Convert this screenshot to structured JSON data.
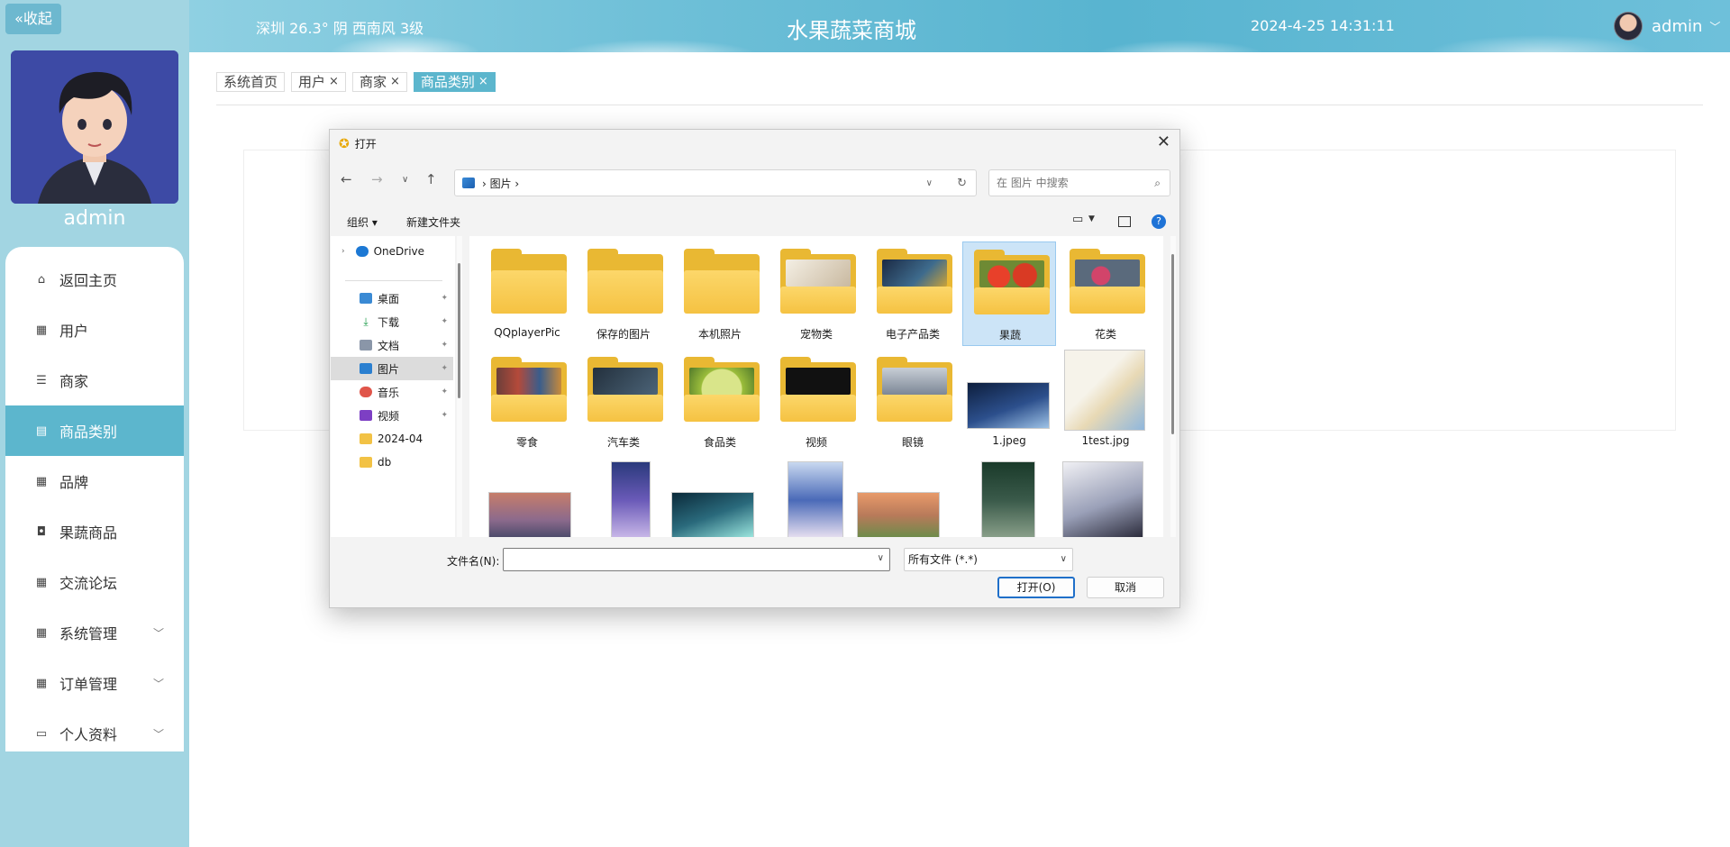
{
  "header": {
    "weather": "深圳  26.3°  阴  西南风  3级",
    "title": "水果蔬菜商城",
    "datetime": "2024-4-25 14:31:11",
    "user": "admin",
    "dropdown_icon": "chevron-down-icon"
  },
  "sidebar": {
    "collapse_label": "«收起",
    "profile_name": "admin",
    "items": [
      {
        "label": "返回主页",
        "icon": "home-icon"
      },
      {
        "label": "用户",
        "icon": "grid-icon"
      },
      {
        "label": "商家",
        "icon": "list-icon"
      },
      {
        "label": "商品类别",
        "icon": "clipboard-icon",
        "active": true
      },
      {
        "label": "品牌",
        "icon": "grid-icon"
      },
      {
        "label": "果蔬商品",
        "icon": "wallet-icon"
      },
      {
        "label": "交流论坛",
        "icon": "grid-icon"
      },
      {
        "label": "系统管理",
        "icon": "grid-icon",
        "expandable": true
      },
      {
        "label": "订单管理",
        "icon": "grid-icon",
        "expandable": true
      },
      {
        "label": "个人资料",
        "icon": "card-icon",
        "expandable": true
      }
    ]
  },
  "tabs": [
    {
      "label": "系统首页",
      "closable": false
    },
    {
      "label": "用户",
      "closable": true
    },
    {
      "label": "商家",
      "closable": true
    },
    {
      "label": "商品类别",
      "closable": true,
      "active": true
    }
  ],
  "tab_close_glyph": "×",
  "dialog": {
    "title": "打开",
    "close_glyph": "✕",
    "breadcrumb": "›  图片  ›",
    "search_placeholder": "在 图片 中搜索",
    "organize": "组织 ▾",
    "new_folder": "新建文件夹",
    "help": "?",
    "nav_items": [
      {
        "label": "OneDrive",
        "icon": "cloud-icon",
        "pinned": false
      },
      {
        "label": "桌面",
        "icon": "desktop-icon",
        "pinned": true
      },
      {
        "label": "下载",
        "icon": "download-icon",
        "pinned": true
      },
      {
        "label": "文档",
        "icon": "document-icon",
        "pinned": true
      },
      {
        "label": "图片",
        "icon": "pictures-icon",
        "pinned": true,
        "selected": true
      },
      {
        "label": "音乐",
        "icon": "music-icon",
        "pinned": true
      },
      {
        "label": "视频",
        "icon": "video-icon",
        "pinned": true
      },
      {
        "label": "2024-04",
        "icon": "folder-icon",
        "pinned": false
      },
      {
        "label": "db",
        "icon": "folder-icon",
        "pinned": false
      }
    ],
    "files": [
      {
        "label": "QQplayerPic",
        "kind": "folder"
      },
      {
        "label": "保存的图片",
        "kind": "folder"
      },
      {
        "label": "本机照片",
        "kind": "folder"
      },
      {
        "label": "宠物类",
        "kind": "photo-folder",
        "color": "#e7e2d8"
      },
      {
        "label": "电子产品类",
        "kind": "photo-folder",
        "color": "#2f4b6a"
      },
      {
        "label": "果蔬",
        "kind": "photo-folder",
        "color": "#d9432a",
        "selected": true
      },
      {
        "label": "花类",
        "kind": "photo-folder",
        "color": "#c9516e"
      },
      {
        "label": "零食",
        "kind": "photo-folder",
        "color": "#6b3f3a"
      },
      {
        "label": "汽车类",
        "kind": "photo-folder",
        "color": "#3a4c5e"
      },
      {
        "label": "食品类",
        "kind": "photo-folder",
        "color": "#a2c04a"
      },
      {
        "label": "视频",
        "kind": "photo-folder",
        "color": "#111111"
      },
      {
        "label": "眼镜",
        "kind": "photo-folder",
        "color": "#7c8796"
      },
      {
        "label": "1.jpeg",
        "kind": "image",
        "color": "#2c4f8c"
      },
      {
        "label": "1test.jpg",
        "kind": "image",
        "color": "#f2efe6"
      }
    ],
    "filename_label": "文件名(N):",
    "filename_value": "",
    "filetype": "所有文件 (*.*)",
    "open_button": "打开(O)",
    "cancel_button": "取消"
  }
}
